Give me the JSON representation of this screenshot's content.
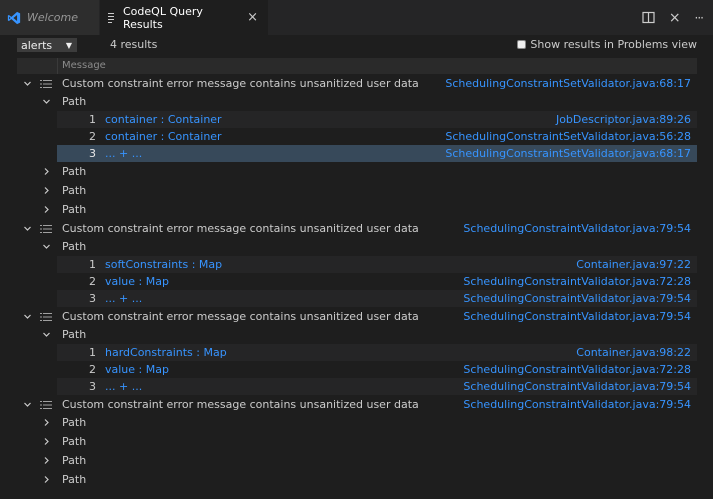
{
  "tabs": [
    {
      "label": "Welcome",
      "icon": "vscode-logo-icon"
    },
    {
      "label": "CodeQL Query Results",
      "icon": "file-lines-icon",
      "close": "×"
    }
  ],
  "tab_actions": {
    "split_icon": "split-editor-icon",
    "more": "···"
  },
  "toolbar": {
    "select_value": "alerts",
    "results_count": "4 results",
    "problems_label": "Show results in Problems view"
  },
  "table": {
    "header": "Message",
    "alerts": [
      {
        "message": "Custom constraint error message contains unsanitized user data",
        "location": "SchedulingConstraintSetValidator.java:68:17",
        "paths": [
          {
            "label": "Path",
            "expanded": true,
            "steps": [
              {
                "num": "1",
                "label": "container : Container",
                "location": "JobDescriptor.java:89:26"
              },
              {
                "num": "2",
                "label": "container : Container",
                "location": "SchedulingConstraintSetValidator.java:56:28"
              },
              {
                "num": "3",
                "label": "... + ...",
                "location": "SchedulingConstraintSetValidator.java:68:17"
              }
            ]
          },
          {
            "label": "Path",
            "expanded": false
          },
          {
            "label": "Path",
            "expanded": false
          },
          {
            "label": "Path",
            "expanded": false
          }
        ]
      },
      {
        "message": "Custom constraint error message contains unsanitized user data",
        "location": "SchedulingConstraintValidator.java:79:54",
        "paths": [
          {
            "label": "Path",
            "expanded": true,
            "steps": [
              {
                "num": "1",
                "label": "softConstraints : Map",
                "location": "Container.java:97:22"
              },
              {
                "num": "2",
                "label": "value : Map",
                "location": "SchedulingConstraintValidator.java:72:28"
              },
              {
                "num": "3",
                "label": "... + ...",
                "location": "SchedulingConstraintValidator.java:79:54"
              }
            ]
          }
        ]
      },
      {
        "message": "Custom constraint error message contains unsanitized user data",
        "location": "SchedulingConstraintValidator.java:79:54",
        "paths": [
          {
            "label": "Path",
            "expanded": true,
            "steps": [
              {
                "num": "1",
                "label": "hardConstraints : Map",
                "location": "Container.java:98:22"
              },
              {
                "num": "2",
                "label": "value : Map",
                "location": "SchedulingConstraintValidator.java:72:28"
              },
              {
                "num": "3",
                "label": "... + ...",
                "location": "SchedulingConstraintValidator.java:79:54"
              }
            ]
          }
        ]
      },
      {
        "message": "Custom constraint error message contains unsanitized user data",
        "location": "SchedulingConstraintValidator.java:79:54",
        "paths": [
          {
            "label": "Path",
            "expanded": false
          },
          {
            "label": "Path",
            "expanded": false
          },
          {
            "label": "Path",
            "expanded": false
          },
          {
            "label": "Path",
            "expanded": false
          }
        ]
      }
    ]
  },
  "colors": {
    "link": "#3794ff",
    "selected_row": "#37495a",
    "background": "#1e1e1e"
  }
}
